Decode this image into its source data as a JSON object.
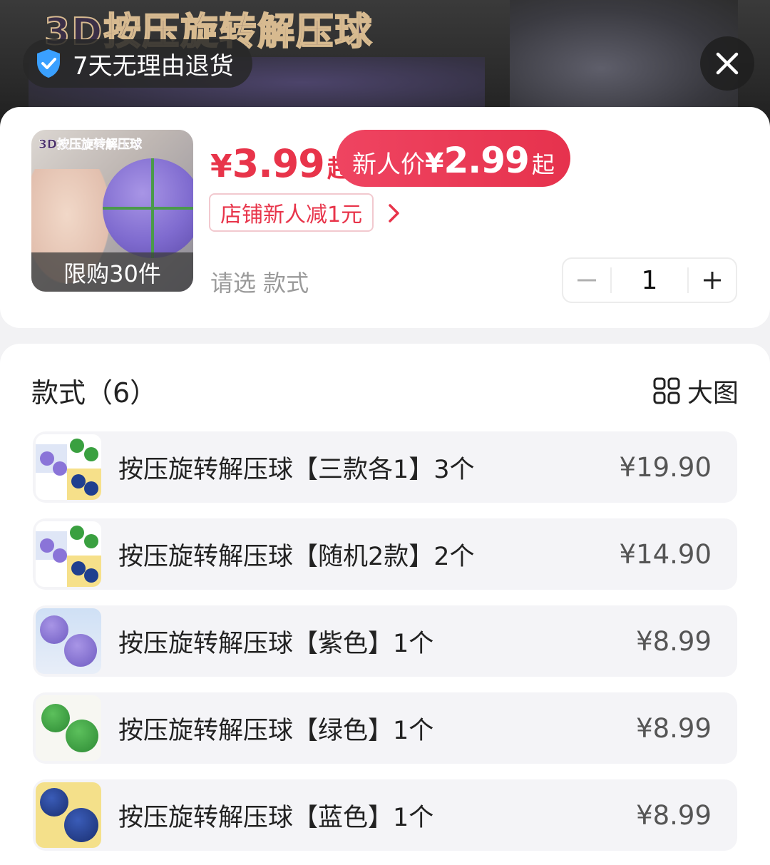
{
  "banner": {
    "title": "3D按压旋转解压球",
    "return_policy": "7天无理由退货"
  },
  "product": {
    "thumb_title": "3D按压旋转解压球",
    "limit": "限购30件",
    "price_yen": "¥",
    "price": "3.99",
    "price_suffix": "起",
    "new_user_label": "新人价",
    "new_user_yen": "¥",
    "new_user_price": "2.99",
    "new_user_suffix": "起",
    "coupon": "店铺新人减1元",
    "select_hint": "请选 款式",
    "quantity": "1"
  },
  "styles": {
    "title": "款式（6）",
    "bigview_label": "大图",
    "options": [
      {
        "name": "按压旋转解压球【三款各1】3个",
        "price": "¥19.90",
        "img": "mix"
      },
      {
        "name": "按压旋转解压球【随机2款】2个",
        "price": "¥14.90",
        "img": "mix"
      },
      {
        "name": "按压旋转解压球【紫色】1个",
        "price": "¥8.99",
        "img": "purple"
      },
      {
        "name": "按压旋转解压球【绿色】1个",
        "price": "¥8.99",
        "img": "green"
      },
      {
        "name": "按压旋转解压球【蓝色】1个",
        "price": "¥8.99",
        "img": "blue"
      }
    ]
  },
  "colors": {
    "accent": "#e8344a",
    "shield": "#3aa0ff",
    "purple_ball": "#8a74d8",
    "green_ball": "#3aa040",
    "blue_ball": "#1f3f8f"
  },
  "icons": {
    "shield": "shield-check-icon",
    "close": "close-icon",
    "arrow": "chevron-right-icon",
    "grid": "grid-icon"
  }
}
